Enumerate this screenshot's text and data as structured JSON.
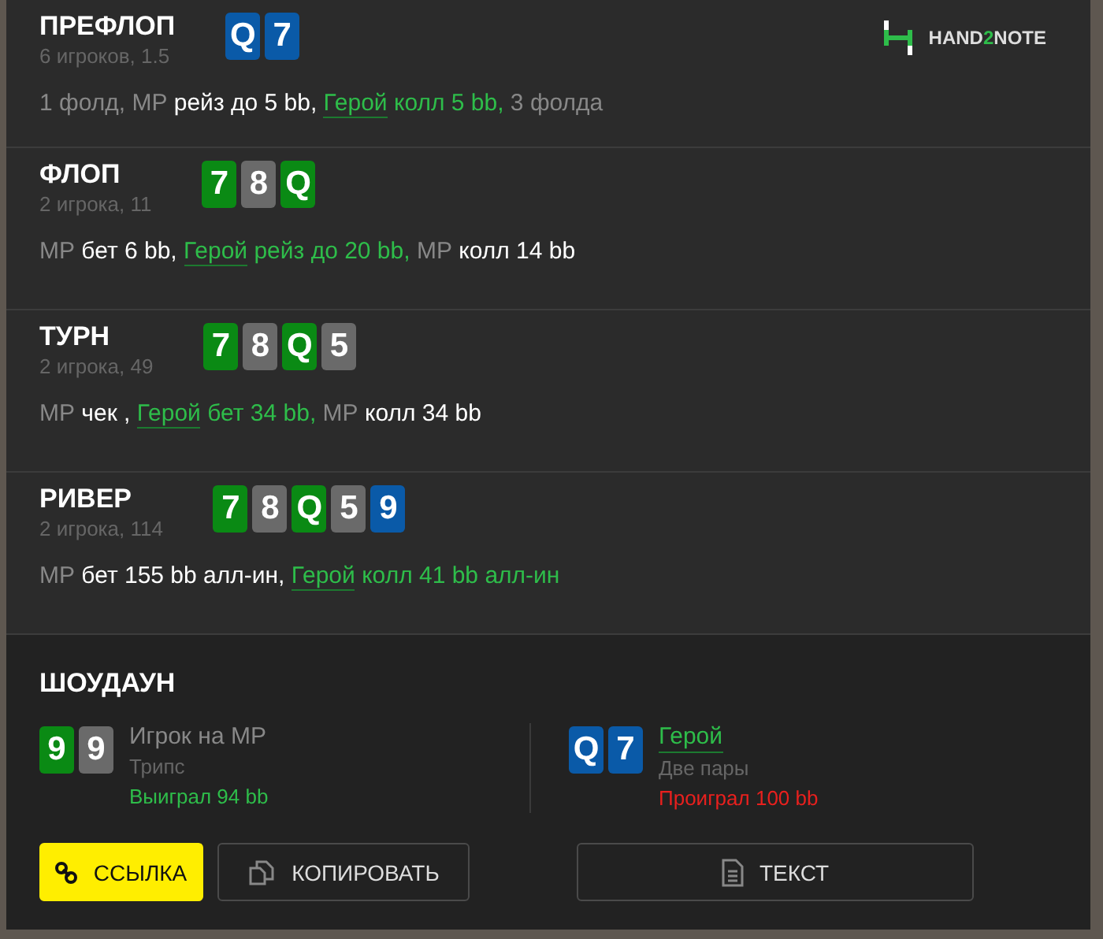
{
  "logo": {
    "parts": [
      {
        "text": "HAND",
        "accent": false
      },
      {
        "text": "2",
        "accent": true
      },
      {
        "text": "NOTE",
        "accent": false
      }
    ]
  },
  "streets": [
    {
      "title": "ПРЕФЛОП",
      "info": "6 игроков, 1.5",
      "cards": [
        {
          "rank": "Q",
          "color": "#0a5aa8"
        },
        {
          "rank": "7",
          "color": "#0a5aa8"
        }
      ],
      "action": [
        {
          "kind": "muted",
          "text": "1 фолд, МР "
        },
        {
          "kind": "plain",
          "text": "рейз до 5 bb, "
        },
        {
          "kind": "hero",
          "text": "Герой"
        },
        {
          "kind": "hero_action",
          "text": " колл 5 bb,"
        },
        {
          "kind": "muted",
          "text": " 3 фолда"
        }
      ]
    },
    {
      "title": "ФЛОП",
      "info": "2 игрока, 11",
      "cards": [
        {
          "rank": "7",
          "color": "#0a8a14"
        },
        {
          "rank": "8",
          "color": "#6a6a6a"
        },
        {
          "rank": "Q",
          "color": "#0a8a14"
        }
      ],
      "action": [
        {
          "kind": "muted",
          "text": "МР "
        },
        {
          "kind": "plain",
          "text": "бет 6 bb, "
        },
        {
          "kind": "hero",
          "text": "Герой"
        },
        {
          "kind": "hero_action",
          "text": " рейз до 20 bb,"
        },
        {
          "kind": "muted",
          "text": " МР "
        },
        {
          "kind": "plain",
          "text": "колл 14 bb"
        }
      ]
    },
    {
      "title": "ТУРН",
      "info": "2 игрока, 49",
      "cards": [
        {
          "rank": "7",
          "color": "#0a8a14"
        },
        {
          "rank": "8",
          "color": "#6a6a6a"
        },
        {
          "rank": "Q",
          "color": "#0a8a14"
        },
        {
          "rank": "5",
          "color": "#6a6a6a"
        }
      ],
      "action": [
        {
          "kind": "muted",
          "text": "МР "
        },
        {
          "kind": "plain",
          "text": "чек , "
        },
        {
          "kind": "hero",
          "text": "Герой"
        },
        {
          "kind": "hero_action",
          "text": " бет 34 bb,"
        },
        {
          "kind": "muted",
          "text": " МР "
        },
        {
          "kind": "plain",
          "text": "колл 34 bb"
        }
      ]
    },
    {
      "title": "РИВЕР",
      "info": "2 игрока, 114",
      "cards": [
        {
          "rank": "7",
          "color": "#0a8a14"
        },
        {
          "rank": "8",
          "color": "#6a6a6a"
        },
        {
          "rank": "Q",
          "color": "#0a8a14"
        },
        {
          "rank": "5",
          "color": "#6a6a6a"
        },
        {
          "rank": "9",
          "color": "#0a5aa8"
        }
      ],
      "action": [
        {
          "kind": "muted",
          "text": "МР "
        },
        {
          "kind": "plain",
          "text": "бет 155 bb алл-ин, "
        },
        {
          "kind": "hero",
          "text": "Герой"
        },
        {
          "kind": "hero_action",
          "text": " колл 41 bb алл-ин"
        }
      ]
    }
  ],
  "showdown": {
    "title": "ШОУДАУН",
    "players": [
      {
        "cards": [
          {
            "rank": "9",
            "color": "#0a8a14"
          },
          {
            "rank": "9",
            "color": "#6a6a6a"
          }
        ],
        "name": "Игрок на МР",
        "is_hero": false,
        "hand": "Трипс",
        "result": "Выиграл 94 bb",
        "won": true
      },
      {
        "cards": [
          {
            "rank": "Q",
            "color": "#0a5aa8"
          },
          {
            "rank": "7",
            "color": "#0a5aa8"
          }
        ],
        "name": "Герой",
        "is_hero": true,
        "hand": "Две пары",
        "result": "Проиграл 100 bb",
        "won": false
      }
    ]
  },
  "buttons": [
    {
      "kind": "link",
      "label": "ССЫЛКА"
    },
    {
      "kind": "copy",
      "label": "КОПИРОВАТЬ"
    },
    {
      "kind": "text",
      "label": "ТЕКСТ"
    }
  ]
}
